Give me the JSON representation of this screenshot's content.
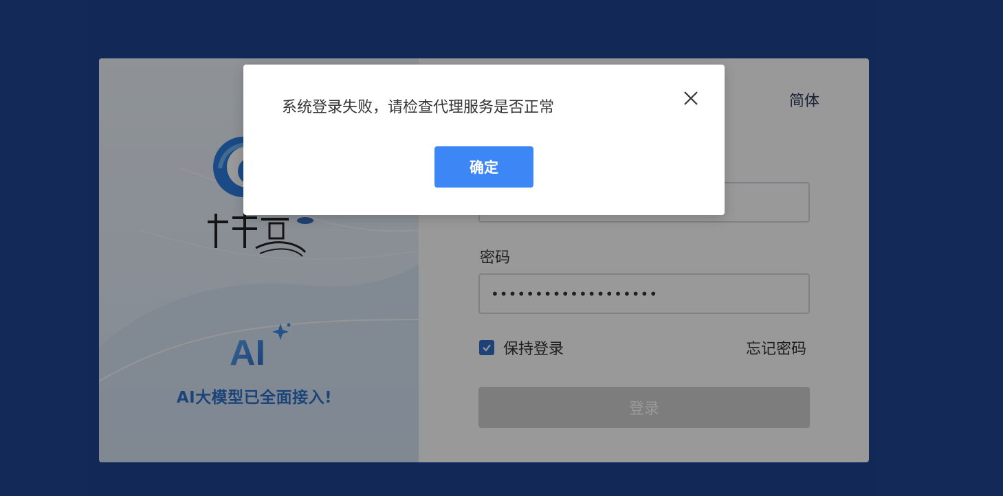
{
  "login": {
    "lang_label": "简体",
    "brand_ai_text": "AI",
    "brand_tagline": "AI大模型已全面接入!",
    "username_value": "",
    "password_label": "密码",
    "password_value": "•••••••••••••••••••",
    "remember_label": "保持登录",
    "remember_checked": true,
    "forgot_label": "忘记密码",
    "login_button_label": "登录"
  },
  "dialog": {
    "message": "系统登录失败，请检查代理服务是否正常",
    "confirm_label": "确定"
  },
  "colors": {
    "page_background": "#1f4591",
    "accent": "#3d86f6",
    "checkbox": "#2f6fc9",
    "tagline": "#2f72c9"
  },
  "icons": {
    "logo": "chandao-logo",
    "close": "close-icon",
    "checkbox": "check-icon",
    "ai_sparkle": "sparkle-icon"
  }
}
